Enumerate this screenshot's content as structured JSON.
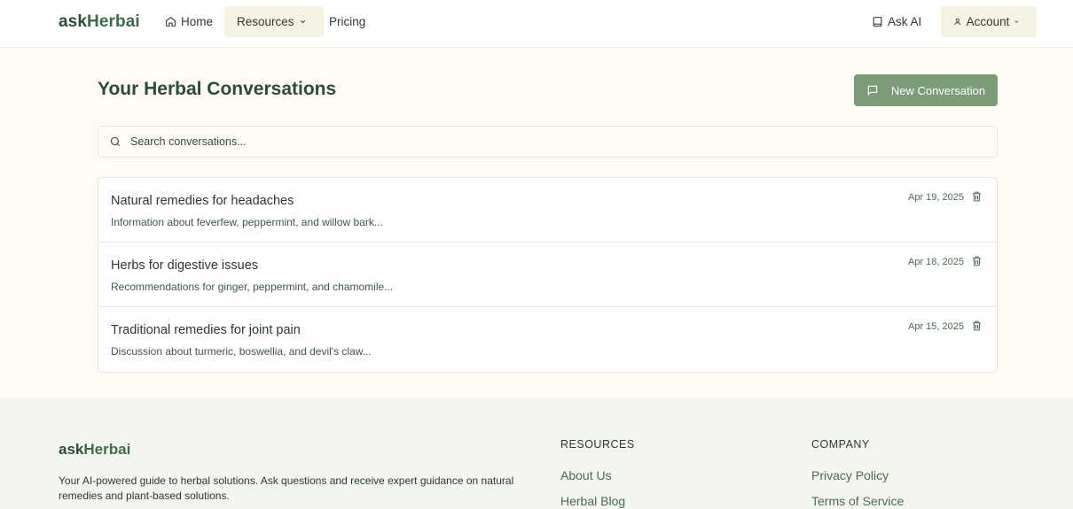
{
  "brand": {
    "prefix": "ask",
    "accent": "Herb",
    "suffix": "ai"
  },
  "nav": {
    "home": "Home",
    "resources": "Resources",
    "pricing": "Pricing",
    "ask_ai": "Ask AI",
    "account": "Account"
  },
  "main": {
    "title": "Your Herbal Conversations",
    "new_button": "New Conversation",
    "search_placeholder": "Search conversations...",
    "conversations": [
      {
        "title": "Natural remedies for headaches",
        "summary": "Information about feverfew, peppermint, and willow bark...",
        "date": "Apr 19, 2025"
      },
      {
        "title": "Herbs for digestive issues",
        "summary": "Recommendations for ginger, peppermint, and chamomile...",
        "date": "Apr 18, 2025"
      },
      {
        "title": "Traditional remedies for joint pain",
        "summary": "Discussion about turmeric, boswellia, and devil's claw...",
        "date": "Apr 15, 2025"
      }
    ]
  },
  "footer": {
    "description": "Your AI-powered guide to herbal solutions. Ask questions and receive expert guidance on natural remedies and plant-based solutions.",
    "resources_heading": "RESOURCES",
    "resources_links": [
      "About Us",
      "Herbal Blog"
    ],
    "company_heading": "COMPANY",
    "company_links": [
      "Privacy Policy",
      "Terms of Service"
    ]
  },
  "colors": {
    "accent": "#7c9b79",
    "brand": "#2f4a36",
    "background": "#fdfbf3"
  },
  "icons": {
    "home": "home-icon",
    "ask": "book-icon",
    "account": "user-icon",
    "new": "chat-icon",
    "search": "search-icon",
    "delete": "trash-icon"
  }
}
